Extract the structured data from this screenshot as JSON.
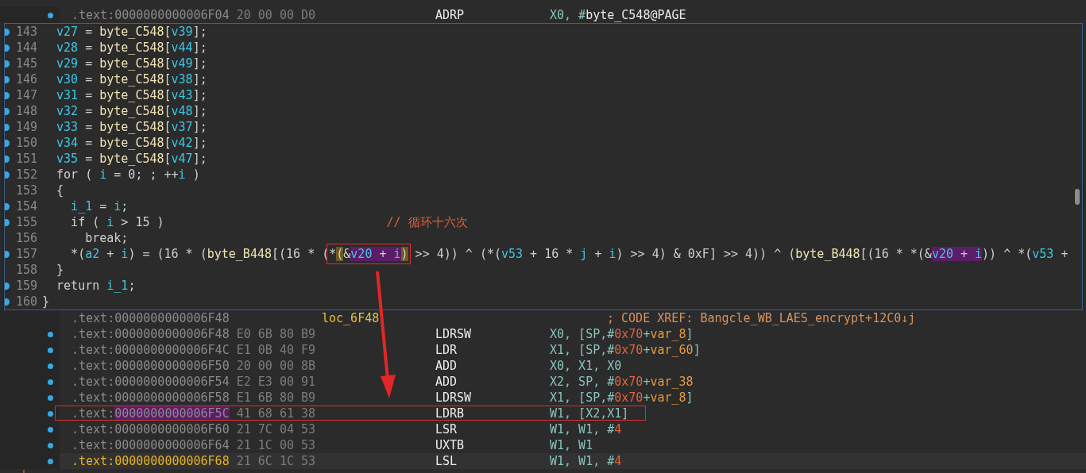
{
  "listing_top": [
    {
      "kind": "instr",
      "dot": true,
      "prefix": ".text:",
      "address": "0000000000006F04",
      "address_highlighted": false,
      "bytes": "20 00 00 D0",
      "mnemonic": "ADRP",
      "operands": [
        {
          "t": "X0, #",
          "kind": "reg"
        },
        {
          "t": "byte_C548@PAGE",
          "kind": "ref"
        }
      ],
      "current": false,
      "boxed": false
    }
  ],
  "pseudocode": {
    "lines": [
      {
        "number": "143",
        "dot": true,
        "tokens": [
          {
            "t": "  v27",
            "kind": "var"
          },
          {
            "t": " = ",
            "kind": "p"
          },
          {
            "t": "byte_C548",
            "kind": "ident"
          },
          {
            "t": "[",
            "kind": "p"
          },
          {
            "t": "v39",
            "kind": "var"
          },
          {
            "t": "];",
            "kind": "p"
          }
        ]
      },
      {
        "number": "144",
        "dot": true,
        "tokens": [
          {
            "t": "  v28",
            "kind": "var"
          },
          {
            "t": " = ",
            "kind": "p"
          },
          {
            "t": "byte_C548",
            "kind": "ident"
          },
          {
            "t": "[",
            "kind": "p"
          },
          {
            "t": "v44",
            "kind": "var"
          },
          {
            "t": "];",
            "kind": "p"
          }
        ]
      },
      {
        "number": "145",
        "dot": true,
        "tokens": [
          {
            "t": "  v29",
            "kind": "var"
          },
          {
            "t": " = ",
            "kind": "p"
          },
          {
            "t": "byte_C548",
            "kind": "ident"
          },
          {
            "t": "[",
            "kind": "p"
          },
          {
            "t": "v49",
            "kind": "var"
          },
          {
            "t": "];",
            "kind": "p"
          }
        ]
      },
      {
        "number": "146",
        "dot": true,
        "tokens": [
          {
            "t": "  v30",
            "kind": "var"
          },
          {
            "t": " = ",
            "kind": "p"
          },
          {
            "t": "byte_C548",
            "kind": "ident"
          },
          {
            "t": "[",
            "kind": "p"
          },
          {
            "t": "v38",
            "kind": "var"
          },
          {
            "t": "];",
            "kind": "p"
          }
        ]
      },
      {
        "number": "147",
        "dot": true,
        "tokens": [
          {
            "t": "  v31",
            "kind": "var"
          },
          {
            "t": " = ",
            "kind": "p"
          },
          {
            "t": "byte_C548",
            "kind": "ident"
          },
          {
            "t": "[",
            "kind": "p"
          },
          {
            "t": "v43",
            "kind": "var"
          },
          {
            "t": "];",
            "kind": "p"
          }
        ]
      },
      {
        "number": "148",
        "dot": true,
        "tokens": [
          {
            "t": "  v32",
            "kind": "var"
          },
          {
            "t": " = ",
            "kind": "p"
          },
          {
            "t": "byte_C548",
            "kind": "ident"
          },
          {
            "t": "[",
            "kind": "p"
          },
          {
            "t": "v48",
            "kind": "var"
          },
          {
            "t": "];",
            "kind": "p"
          }
        ]
      },
      {
        "number": "149",
        "dot": true,
        "tokens": [
          {
            "t": "  v33",
            "kind": "var"
          },
          {
            "t": " = ",
            "kind": "p"
          },
          {
            "t": "byte_C548",
            "kind": "ident"
          },
          {
            "t": "[",
            "kind": "p"
          },
          {
            "t": "v37",
            "kind": "var"
          },
          {
            "t": "];",
            "kind": "p"
          }
        ]
      },
      {
        "number": "150",
        "dot": true,
        "tokens": [
          {
            "t": "  v34",
            "kind": "var"
          },
          {
            "t": " = ",
            "kind": "p"
          },
          {
            "t": "byte_C548",
            "kind": "ident"
          },
          {
            "t": "[",
            "kind": "p"
          },
          {
            "t": "v42",
            "kind": "var"
          },
          {
            "t": "];",
            "kind": "p"
          }
        ]
      },
      {
        "number": "151",
        "dot": true,
        "tokens": [
          {
            "t": "  v35",
            "kind": "var"
          },
          {
            "t": " = ",
            "kind": "p"
          },
          {
            "t": "byte_C548",
            "kind": "ident"
          },
          {
            "t": "[",
            "kind": "p"
          },
          {
            "t": "v47",
            "kind": "var"
          },
          {
            "t": "];",
            "kind": "p"
          }
        ]
      },
      {
        "number": "152",
        "dot": true,
        "tokens": [
          {
            "t": "  for ( ",
            "kind": "p"
          },
          {
            "t": "i",
            "kind": "var"
          },
          {
            "t": " = 0; ; ++",
            "kind": "p"
          },
          {
            "t": "i",
            "kind": "var"
          },
          {
            "t": " )",
            "kind": "p"
          }
        ]
      },
      {
        "number": "153",
        "dot": false,
        "tokens": [
          {
            "t": "  {",
            "kind": "p"
          }
        ]
      },
      {
        "number": "154",
        "dot": true,
        "tokens": [
          {
            "t": "    i_1",
            "kind": "var"
          },
          {
            "t": " = ",
            "kind": "p"
          },
          {
            "t": "i",
            "kind": "var"
          },
          {
            "t": ";",
            "kind": "p"
          }
        ]
      },
      {
        "number": "155",
        "dot": true,
        "tokens": [
          {
            "t": "    if ( ",
            "kind": "p"
          },
          {
            "t": "i",
            "kind": "var"
          },
          {
            "t": " > 15 )",
            "kind": "p"
          },
          {
            "t": "                               // 循环十六次",
            "kind": "comment"
          }
        ]
      },
      {
        "number": "156",
        "dot": false,
        "tokens": [
          {
            "t": "      break;",
            "kind": "p"
          }
        ]
      },
      {
        "number": "157",
        "dot": true,
        "tokens": [
          {
            "t": "    *(",
            "kind": "p"
          },
          {
            "t": "a2",
            "kind": "var"
          },
          {
            "t": " + ",
            "kind": "p"
          },
          {
            "t": "i",
            "kind": "var"
          },
          {
            "t": ") = (16 * (",
            "kind": "p"
          },
          {
            "t": "byte_B448",
            "kind": "ident"
          },
          {
            "t": "[(16 * (",
            "kind": "p"
          },
          {
            "kind": "group",
            "boxed": true,
            "parts": [
              {
                "t": "*",
                "kind": "p"
              },
              {
                "t": "(",
                "kind": "p",
                "brace_match": true
              },
              {
                "t": "&",
                "kind": "p"
              },
              {
                "t": "v20",
                "kind": "var",
                "selected": true
              },
              {
                "t": " + ",
                "kind": "p",
                "selected": true
              },
              {
                "t": "i",
                "kind": "var",
                "selected": true
              },
              {
                "t": ")",
                "kind": "p",
                "brace_match": true
              }
            ]
          },
          {
            "t": " >> 4)) ^ (*(",
            "kind": "p"
          },
          {
            "t": "v53",
            "kind": "var"
          },
          {
            "t": " + 16 * ",
            "kind": "p"
          },
          {
            "t": "j",
            "kind": "var"
          },
          {
            "t": " + ",
            "kind": "p"
          },
          {
            "t": "i",
            "kind": "var"
          },
          {
            "t": ") >> 4) & 0xF] >> 4)) ^ (",
            "kind": "p"
          },
          {
            "t": "byte_B448",
            "kind": "ident"
          },
          {
            "t": "[(16 * *(&",
            "kind": "p"
          },
          {
            "t": "v20",
            "kind": "var",
            "selected": true
          },
          {
            "t": " + ",
            "kind": "p",
            "selected": true
          },
          {
            "t": "i",
            "kind": "var",
            "selected": true
          },
          {
            "t": ")) ^ *(",
            "kind": "p"
          },
          {
            "t": "v53",
            "kind": "var"
          },
          {
            "t": " +",
            "kind": "p"
          }
        ]
      },
      {
        "number": "158",
        "dot": false,
        "tokens": [
          {
            "t": "  }",
            "kind": "p"
          }
        ]
      },
      {
        "number": "159",
        "dot": true,
        "tokens": [
          {
            "t": "  return ",
            "kind": "p"
          },
          {
            "t": "i_1",
            "kind": "var"
          },
          {
            "t": ";",
            "kind": "p"
          }
        ]
      },
      {
        "number": "160",
        "dot": true,
        "tokens": [
          {
            "t": "}",
            "kind": "p"
          }
        ]
      }
    ]
  },
  "listing_bottom": [
    {
      "kind": "label",
      "dot": false,
      "prefix": ".text:",
      "address": "0000000000006F48",
      "address_highlighted": false,
      "label": "loc_6F48",
      "comment": "; CODE XREF: Bangcle_WB_LAES_encrypt+12C0↓j",
      "current": false,
      "boxed": false
    },
    {
      "kind": "instr",
      "dot": true,
      "prefix": ".text:",
      "address": "0000000000006F48",
      "address_highlighted": false,
      "bytes": "E0 6B 80 B9",
      "mnemonic": "LDRSW",
      "operands": [
        {
          "t": "X0, [SP,#",
          "kind": "reg"
        },
        {
          "t": "0x70",
          "kind": "num"
        },
        {
          "t": "+",
          "kind": "reg"
        },
        {
          "t": "var_8",
          "kind": "sym"
        },
        {
          "t": "]",
          "kind": "reg"
        }
      ],
      "current": false,
      "boxed": false
    },
    {
      "kind": "instr",
      "dot": true,
      "prefix": ".text:",
      "address": "0000000000006F4C",
      "address_highlighted": false,
      "bytes": "E1 0B 40 F9",
      "mnemonic": "LDR",
      "operands": [
        {
          "t": "X1, [SP,#",
          "kind": "reg"
        },
        {
          "t": "0x70",
          "kind": "num"
        },
        {
          "t": "+",
          "kind": "reg"
        },
        {
          "t": "var_60",
          "kind": "sym"
        },
        {
          "t": "]",
          "kind": "reg"
        }
      ],
      "current": false,
      "boxed": false
    },
    {
      "kind": "instr",
      "dot": true,
      "prefix": ".text:",
      "address": "0000000000006F50",
      "address_highlighted": false,
      "bytes": "20 00 00 8B",
      "mnemonic": "ADD",
      "operands": [
        {
          "t": "X0, X1, X0",
          "kind": "reg"
        }
      ],
      "current": false,
      "boxed": false
    },
    {
      "kind": "instr",
      "dot": true,
      "prefix": ".text:",
      "address": "0000000000006F54",
      "address_highlighted": false,
      "bytes": "E2 E3 00 91",
      "mnemonic": "ADD",
      "operands": [
        {
          "t": "X2, SP, #",
          "kind": "reg"
        },
        {
          "t": "0x70",
          "kind": "num"
        },
        {
          "t": "+",
          "kind": "reg"
        },
        {
          "t": "var_38",
          "kind": "sym"
        }
      ],
      "current": false,
      "boxed": false
    },
    {
      "kind": "instr",
      "dot": true,
      "prefix": ".text:",
      "address": "0000000000006F58",
      "address_highlighted": false,
      "bytes": "E1 6B 80 B9",
      "mnemonic": "LDRSW",
      "operands": [
        {
          "t": "X1, [SP,#",
          "kind": "reg"
        },
        {
          "t": "0x70",
          "kind": "num"
        },
        {
          "t": "+",
          "kind": "reg"
        },
        {
          "t": "var_8",
          "kind": "sym"
        },
        {
          "t": "]",
          "kind": "reg"
        }
      ],
      "current": false,
      "boxed": false
    },
    {
      "kind": "instr",
      "dot": true,
      "prefix": ".text:",
      "address": "0000000000006F5C",
      "address_highlighted": true,
      "bytes": "41 68 61 38",
      "mnemonic": "LDRB",
      "operands": [
        {
          "t": "W1, [X2,X1]",
          "kind": "reg"
        }
      ],
      "current": false,
      "boxed": true
    },
    {
      "kind": "instr",
      "dot": true,
      "prefix": ".text:",
      "address": "0000000000006F60",
      "address_highlighted": false,
      "bytes": "21 7C 04 53",
      "mnemonic": "LSR",
      "operands": [
        {
          "t": "W1, W1, #",
          "kind": "reg"
        },
        {
          "t": "4",
          "kind": "num"
        }
      ],
      "current": false,
      "boxed": false
    },
    {
      "kind": "instr",
      "dot": true,
      "prefix": ".text:",
      "address": "0000000000006F64",
      "address_highlighted": false,
      "bytes": "21 1C 00 53",
      "mnemonic": "UXTB",
      "operands": [
        {
          "t": "W1, W1",
          "kind": "reg"
        }
      ],
      "current": false,
      "boxed": false
    },
    {
      "kind": "instr",
      "dot": true,
      "prefix": ".text:",
      "address": "0000000000006F68",
      "address_highlighted": false,
      "bytes": "21 6C 1C 53",
      "mnemonic": "LSL",
      "operands": [
        {
          "t": "W1, W1, #",
          "kind": "reg"
        },
        {
          "t": "4",
          "kind": "num"
        }
      ],
      "current": true,
      "boxed": false
    }
  ]
}
